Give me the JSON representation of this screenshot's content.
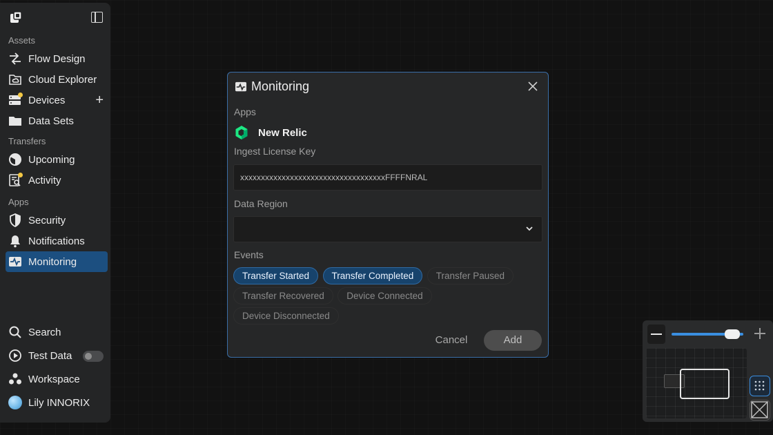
{
  "sidebar": {
    "sections": {
      "assets": "Assets",
      "transfers": "Transfers",
      "apps": "Apps"
    },
    "items": {
      "flow_design": "Flow Design",
      "cloud_explorer": "Cloud Explorer",
      "devices": "Devices",
      "data_sets": "Data Sets",
      "upcoming": "Upcoming",
      "activity": "Activity",
      "security": "Security",
      "notifications": "Notifications",
      "monitoring": "Monitoring"
    },
    "bottom": {
      "search": "Search",
      "test_data": "Test Data",
      "workspace": "Workspace",
      "user": "Lily INNORIX"
    },
    "active_item": "Monitoring",
    "accent_color": "#1c4f80",
    "badge_color": "#f2c744"
  },
  "dialog": {
    "title": "Monitoring",
    "apps_label": "Apps",
    "app_name": "New Relic",
    "license_label": "Ingest License Key",
    "license_value": "xxxxxxxxxxxxxxxxxxxxxxxxxxxxxxxxxxxFFFFNRAL",
    "region_label": "Data Region",
    "region_value": "",
    "events_label": "Events",
    "events": [
      {
        "label": "Transfer Started",
        "selected": true
      },
      {
        "label": "Transfer Completed",
        "selected": true
      },
      {
        "label": "Transfer Paused",
        "selected": false
      },
      {
        "label": "Transfer Recovered",
        "selected": false
      },
      {
        "label": "Device Connected",
        "selected": false
      },
      {
        "label": "Device Disconnected",
        "selected": false
      }
    ],
    "cancel_label": "Cancel",
    "add_label": "Add",
    "border_color": "#3a6ea8"
  },
  "minimap": {
    "zoom_level": 0.85
  }
}
